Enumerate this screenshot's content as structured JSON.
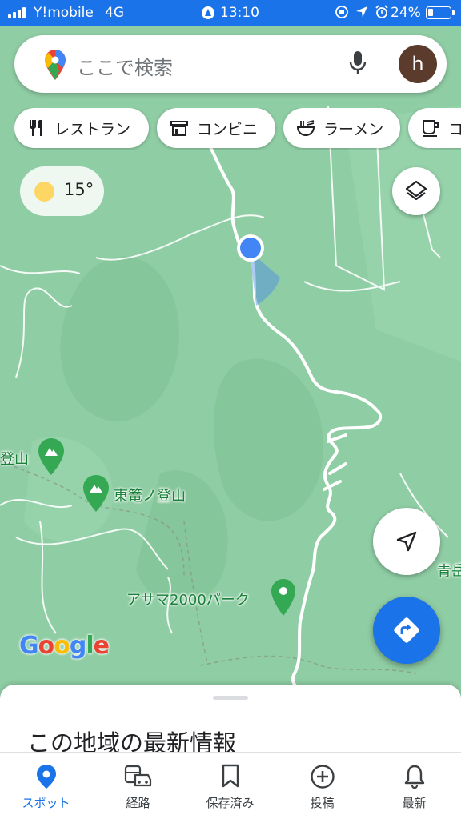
{
  "status_bar": {
    "carrier": "Y!mobile",
    "network": "4G",
    "time": "13:10",
    "battery_percent": "24%",
    "battery_level": 0.24,
    "icons": [
      "signal-icon",
      "location-services-icon",
      "rotation-lock-icon",
      "location-arrow-icon",
      "alarm-icon",
      "battery-icon"
    ]
  },
  "search": {
    "placeholder": "ここで検索",
    "avatar_letter": "h",
    "icons": [
      "maps-pin-icon",
      "microphone-icon"
    ]
  },
  "chips": [
    {
      "label": "レストラン",
      "icon": "restaurant-icon"
    },
    {
      "label": "コンビニ",
      "icon": "store-icon"
    },
    {
      "label": "ラーメン",
      "icon": "ramen-icon"
    },
    {
      "label": "コ",
      "icon": "coffee-icon"
    }
  ],
  "weather": {
    "temperature": "15°",
    "icon": "sun-icon"
  },
  "map": {
    "labels": [
      {
        "text": "登山",
        "kind": "partial"
      },
      {
        "text": "東篭ノ登山"
      },
      {
        "text": "アサマ2000パーク"
      },
      {
        "text": "青岳",
        "kind": "partial"
      }
    ],
    "logo": "Google",
    "colors": {
      "land": "#8fcda4",
      "road": "#ffffff",
      "pin": "#34a853",
      "accent": "#1a73e8"
    }
  },
  "buttons": {
    "layers": "layers-icon",
    "my_location": "navigation-arrow-icon",
    "directions": "directions-icon"
  },
  "sheet": {
    "title": "この地域の最新情報"
  },
  "bottom_nav": [
    {
      "label": "スポット",
      "icon": "location-pin-icon",
      "active": true
    },
    {
      "label": "経路",
      "icon": "car-bus-icon",
      "active": false
    },
    {
      "label": "保存済み",
      "icon": "bookmark-icon",
      "active": false
    },
    {
      "label": "投稿",
      "icon": "add-circle-icon",
      "active": false
    },
    {
      "label": "最新",
      "icon": "bell-icon",
      "active": false
    }
  ]
}
